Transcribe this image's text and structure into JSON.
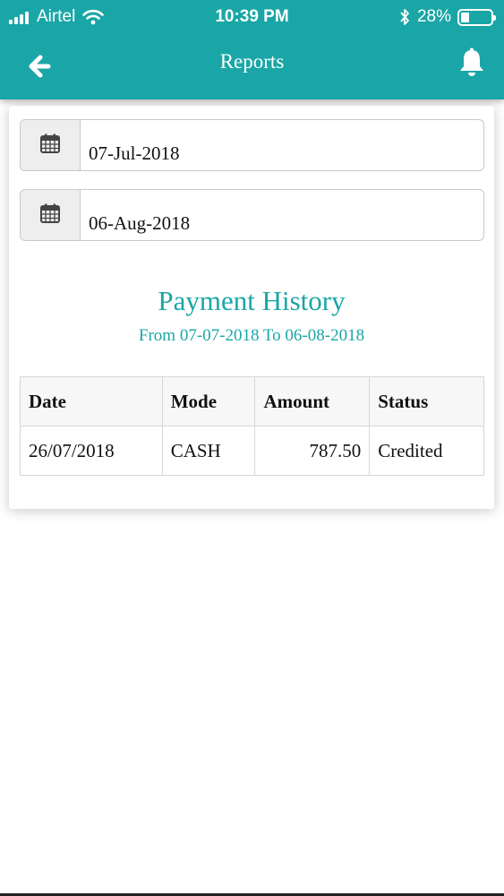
{
  "status_bar": {
    "carrier": "Airtel",
    "time": "10:39 PM",
    "battery_percent": "28%",
    "battery_level": 0.28
  },
  "header": {
    "title": "Reports",
    "back_icon": "back-arrow-icon",
    "notification_icon": "bell-icon"
  },
  "filters": {
    "from_date": "07-Jul-2018",
    "to_date": "06-Aug-2018",
    "date_icon": "calendar-icon"
  },
  "report": {
    "title": "Payment History",
    "subtitle": "From 07-07-2018 To 06-08-2018"
  },
  "table": {
    "columns": [
      "Date",
      "Mode",
      "Amount",
      "Status"
    ],
    "rows": [
      [
        "26/07/2018",
        "CASH",
        "787.50",
        "Credited"
      ]
    ]
  },
  "colors": {
    "accent": "#1aa6a6",
    "header_text": "#ffffff"
  }
}
